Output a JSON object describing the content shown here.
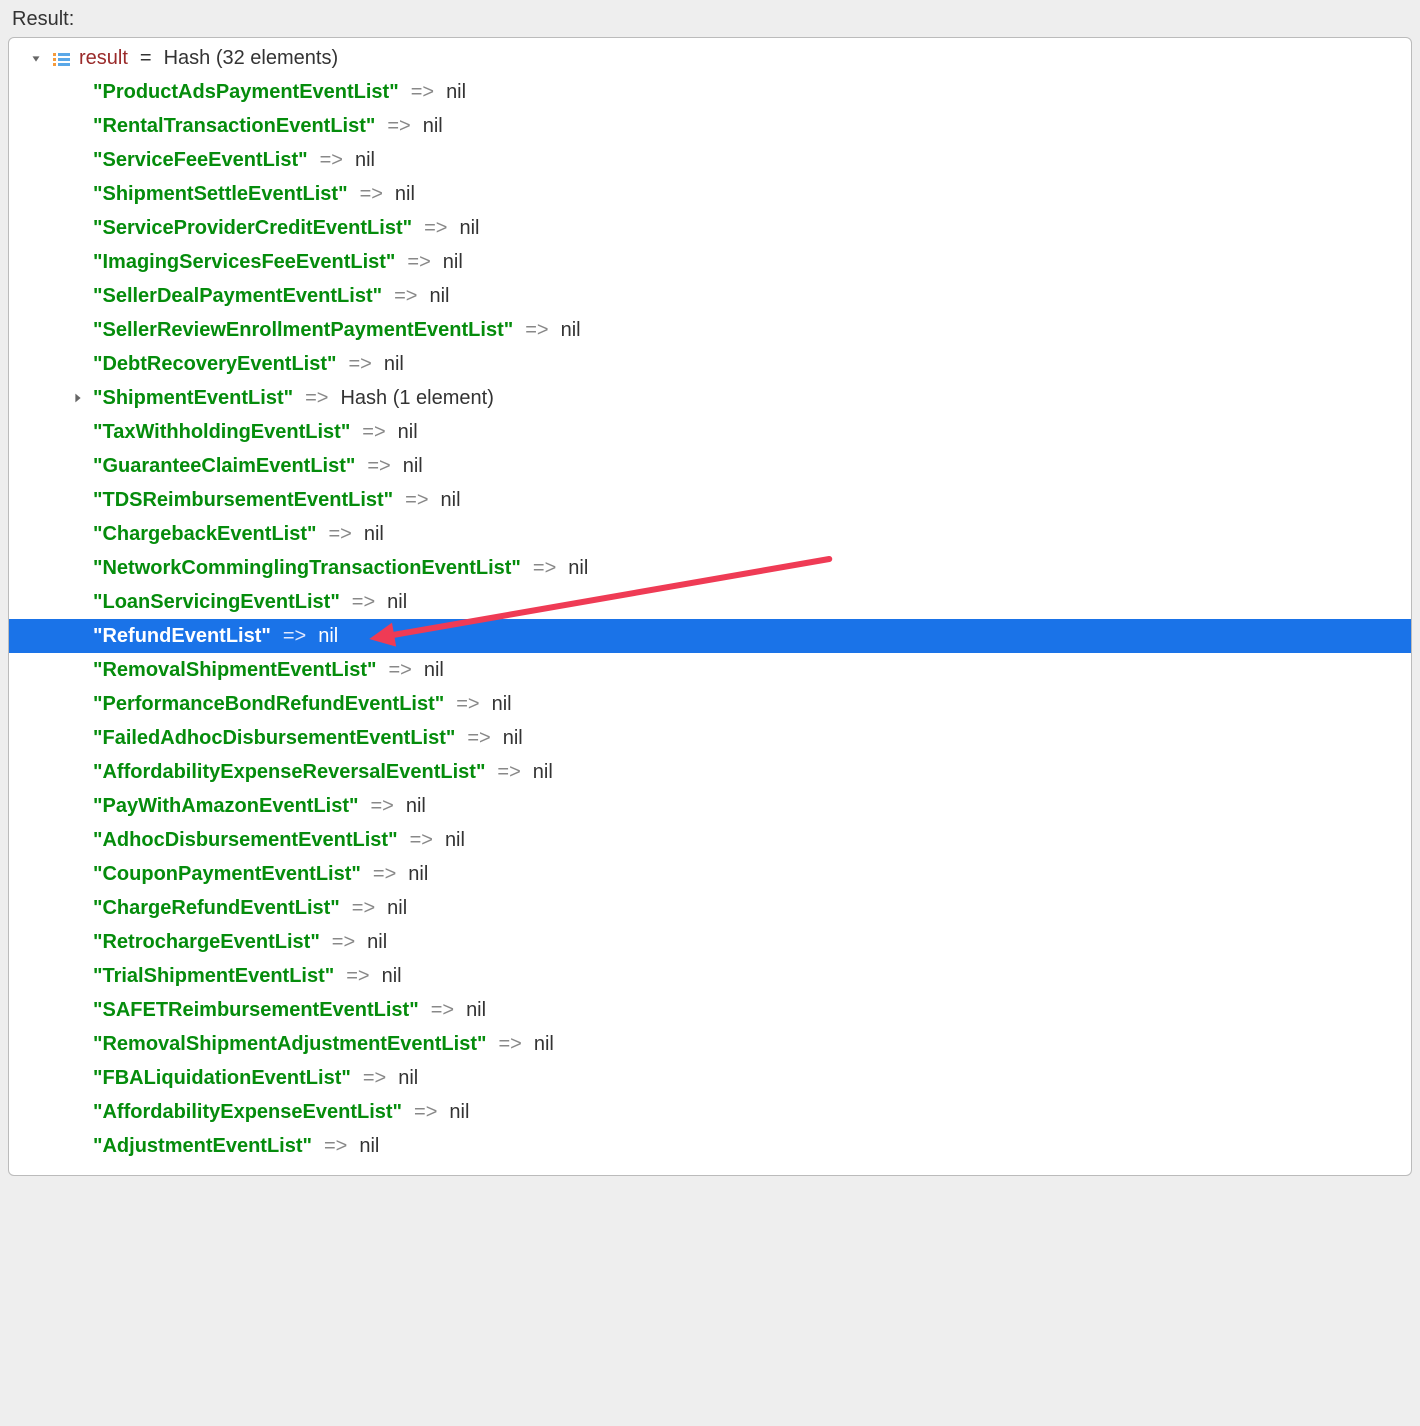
{
  "header": {
    "label": "Result:"
  },
  "root": {
    "varName": "result",
    "equals": "=",
    "typeDesc": "Hash (32 elements)"
  },
  "arrowOp": "=>",
  "nilText": "nil",
  "hashValueDesc": "Hash (1 element)",
  "entries": [
    {
      "key": "\"ProductAdsPaymentEventList\"",
      "type": "nil"
    },
    {
      "key": "\"RentalTransactionEventList\"",
      "type": "nil"
    },
    {
      "key": "\"ServiceFeeEventList\"",
      "type": "nil"
    },
    {
      "key": "\"ShipmentSettleEventList\"",
      "type": "nil"
    },
    {
      "key": "\"ServiceProviderCreditEventList\"",
      "type": "nil"
    },
    {
      "key": "\"ImagingServicesFeeEventList\"",
      "type": "nil"
    },
    {
      "key": "\"SellerDealPaymentEventList\"",
      "type": "nil"
    },
    {
      "key": "\"SellerReviewEnrollmentPaymentEventList\"",
      "type": "nil"
    },
    {
      "key": "\"DebtRecoveryEventList\"",
      "type": "nil"
    },
    {
      "key": "\"ShipmentEventList\"",
      "type": "hash",
      "expandable": true
    },
    {
      "key": "\"TaxWithholdingEventList\"",
      "type": "nil"
    },
    {
      "key": "\"GuaranteeClaimEventList\"",
      "type": "nil"
    },
    {
      "key": "\"TDSReimbursementEventList\"",
      "type": "nil"
    },
    {
      "key": "\"ChargebackEventList\"",
      "type": "nil"
    },
    {
      "key": "\"NetworkComminglingTransactionEventList\"",
      "type": "nil"
    },
    {
      "key": "\"LoanServicingEventList\"",
      "type": "nil"
    },
    {
      "key": "\"RefundEventList\"",
      "type": "nil",
      "selected": true
    },
    {
      "key": "\"RemovalShipmentEventList\"",
      "type": "nil"
    },
    {
      "key": "\"PerformanceBondRefundEventList\"",
      "type": "nil"
    },
    {
      "key": "\"FailedAdhocDisbursementEventList\"",
      "type": "nil"
    },
    {
      "key": "\"AffordabilityExpenseReversalEventList\"",
      "type": "nil"
    },
    {
      "key": "\"PayWithAmazonEventList\"",
      "type": "nil"
    },
    {
      "key": "\"AdhocDisbursementEventList\"",
      "type": "nil"
    },
    {
      "key": "\"CouponPaymentEventList\"",
      "type": "nil"
    },
    {
      "key": "\"ChargeRefundEventList\"",
      "type": "nil"
    },
    {
      "key": "\"RetrochargeEventList\"",
      "type": "nil"
    },
    {
      "key": "\"TrialShipmentEventList\"",
      "type": "nil"
    },
    {
      "key": "\"SAFETReimbursementEventList\"",
      "type": "nil"
    },
    {
      "key": "\"RemovalShipmentAdjustmentEventList\"",
      "type": "nil"
    },
    {
      "key": "\"FBALiquidationEventList\"",
      "type": "nil"
    },
    {
      "key": "\"AffordabilityExpenseEventList\"",
      "type": "nil"
    },
    {
      "key": "\"AdjustmentEventList\"",
      "type": "nil"
    }
  ],
  "annotation": {
    "color": "#ef3b55"
  }
}
